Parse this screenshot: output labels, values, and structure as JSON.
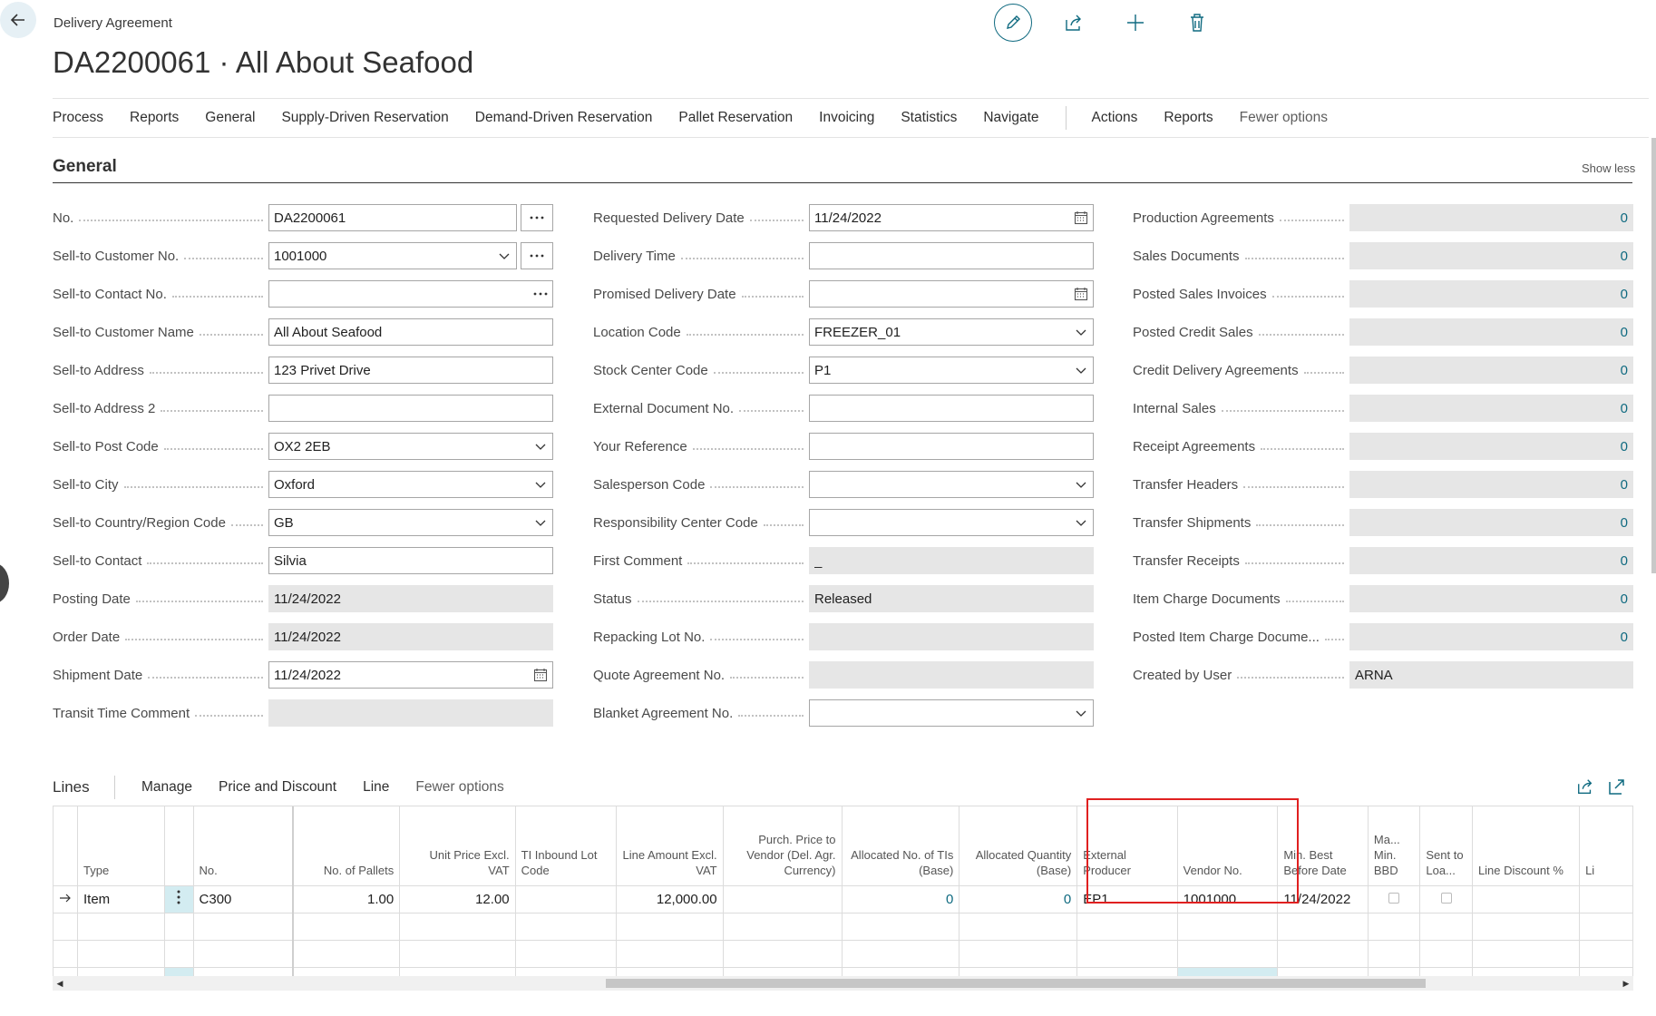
{
  "header": {
    "breadcrumb": "Delivery Agreement",
    "title": "DA2200061 · All About Seafood"
  },
  "menu": {
    "items": [
      "Process",
      "Reports",
      "General",
      "Supply-Driven Reservation",
      "Demand-Driven Reservation",
      "Pallet Reservation",
      "Invoicing",
      "Statistics",
      "Navigate"
    ],
    "items_right": [
      "Actions",
      "Reports"
    ],
    "fewer_options": "Fewer options"
  },
  "general": {
    "title": "General",
    "show_less": "Show less",
    "col1": [
      {
        "label": "No.",
        "value": "DA2200061"
      },
      {
        "label": "Sell-to Customer No.",
        "value": "1001000"
      },
      {
        "label": "Sell-to Contact No.",
        "value": ""
      },
      {
        "label": "Sell-to Customer Name",
        "value": "All About Seafood"
      },
      {
        "label": "Sell-to Address",
        "value": "123 Privet Drive"
      },
      {
        "label": "Sell-to Address 2",
        "value": ""
      },
      {
        "label": "Sell-to Post Code",
        "value": "OX2 2EB"
      },
      {
        "label": "Sell-to City",
        "value": "Oxford"
      },
      {
        "label": "Sell-to Country/Region Code",
        "value": "GB"
      },
      {
        "label": "Sell-to Contact",
        "value": "Silvia"
      },
      {
        "label": "Posting Date",
        "value": "11/24/2022"
      },
      {
        "label": "Order Date",
        "value": "11/24/2022"
      },
      {
        "label": "Shipment Date",
        "value": "11/24/2022"
      },
      {
        "label": "Transit Time Comment",
        "value": ""
      }
    ],
    "col2": [
      {
        "label": "Requested Delivery Date",
        "value": "11/24/2022"
      },
      {
        "label": "Delivery Time",
        "value": ""
      },
      {
        "label": "Promised Delivery Date",
        "value": ""
      },
      {
        "label": "Location Code",
        "value": "FREEZER_01"
      },
      {
        "label": "Stock Center Code",
        "value": "P1"
      },
      {
        "label": "External Document No.",
        "value": ""
      },
      {
        "label": "Your Reference",
        "value": ""
      },
      {
        "label": "Salesperson Code",
        "value": ""
      },
      {
        "label": "Responsibility Center Code",
        "value": ""
      },
      {
        "label": "First Comment",
        "value": "_"
      },
      {
        "label": "Status",
        "value": "Released"
      },
      {
        "label": "Repacking Lot No.",
        "value": ""
      },
      {
        "label": "Quote Agreement No.",
        "value": ""
      },
      {
        "label": "Blanket Agreement No.",
        "value": ""
      }
    ],
    "col3": [
      {
        "label": "Production Agreements",
        "value": "0"
      },
      {
        "label": "Sales Documents",
        "value": "0"
      },
      {
        "label": "Posted Sales Invoices",
        "value": "0"
      },
      {
        "label": "Posted Credit Sales",
        "value": "0"
      },
      {
        "label": "Credit Delivery Agreements",
        "value": "0"
      },
      {
        "label": "Internal Sales",
        "value": "0"
      },
      {
        "label": "Receipt Agreements",
        "value": "0"
      },
      {
        "label": "Transfer Headers",
        "value": "0"
      },
      {
        "label": "Transfer Shipments",
        "value": "0"
      },
      {
        "label": "Transfer Receipts",
        "value": "0"
      },
      {
        "label": "Item Charge Documents",
        "value": "0"
      },
      {
        "label": "Posted Item Charge Docume...",
        "value": "0"
      },
      {
        "label": "Created by User",
        "value": "ARNA"
      }
    ]
  },
  "lines": {
    "title": "Lines",
    "menu": [
      "Manage",
      "Price and Discount",
      "Line"
    ],
    "fewer_options": "Fewer options",
    "headers": {
      "type": "Type",
      "no": "No.",
      "pallets": "No. of Pallets",
      "unit_price": "Unit Price Excl. VAT",
      "ti_lot": "TI Inbound Lot Code",
      "line_amount": "Line Amount Excl. VAT",
      "purch_price": "Purch. Price to Vendor (Del. Agr. Currency)",
      "alloc_tis": "Allocated No. of TIs (Base)",
      "alloc_qty": "Allocated Quantity (Base)",
      "ext_producer": "External Producer",
      "vendor_no": "Vendor No.",
      "min_best": "Min. Best Before Date",
      "ma_min_bbd": "Ma... Min. BBD",
      "sent_to_loa": "Sent to Loa...",
      "line_discount": "Line Discount %",
      "li": "Li"
    },
    "row": {
      "type": "Item",
      "no": "C300",
      "pallets": "1.00",
      "unit_price": "12.00",
      "ti_lot": "",
      "line_amount": "12,000.00",
      "purch_price": "",
      "alloc_tis": "0",
      "alloc_qty": "0",
      "ext_producer": "EP1",
      "vendor_no": "1001000",
      "min_best": "11/24/2022"
    }
  }
}
